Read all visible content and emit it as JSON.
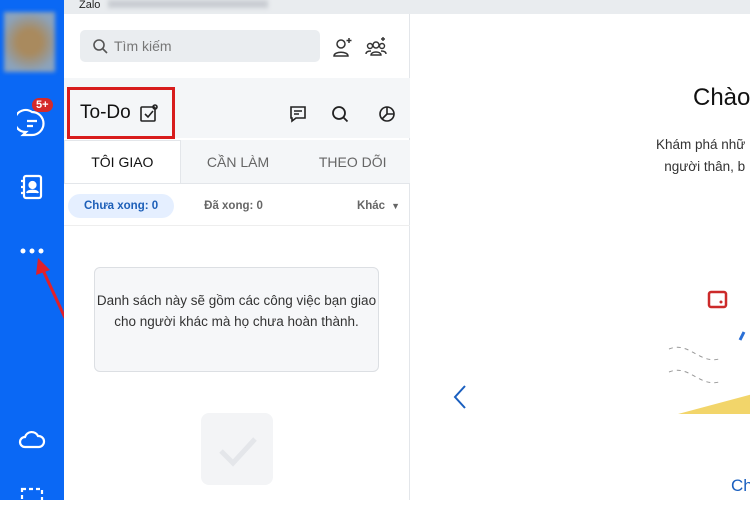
{
  "window": {
    "title": "Zalo"
  },
  "rail": {
    "badge": "5+"
  },
  "search": {
    "placeholder": "Tìm kiếm"
  },
  "todo": {
    "title": "To-Do",
    "tabs": [
      {
        "label": "TÔI GIAO"
      },
      {
        "label": "CẦN LÀM"
      },
      {
        "label": "THEO DÕI"
      }
    ],
    "filters": {
      "pending": "Chưa xong: 0",
      "done": "Đã xong: 0",
      "other": "Khác"
    },
    "empty_text": "Danh sách này sẽ gồm các công việc bạn giao cho người khác mà họ chưa hoàn thành."
  },
  "welcome": {
    "title": "Chào",
    "line1": "Khám phá nhữ",
    "line2": "người thân, b",
    "cta": "Ch"
  },
  "colors": {
    "accent": "#0a68f5",
    "highlight": "#d81c1c"
  }
}
